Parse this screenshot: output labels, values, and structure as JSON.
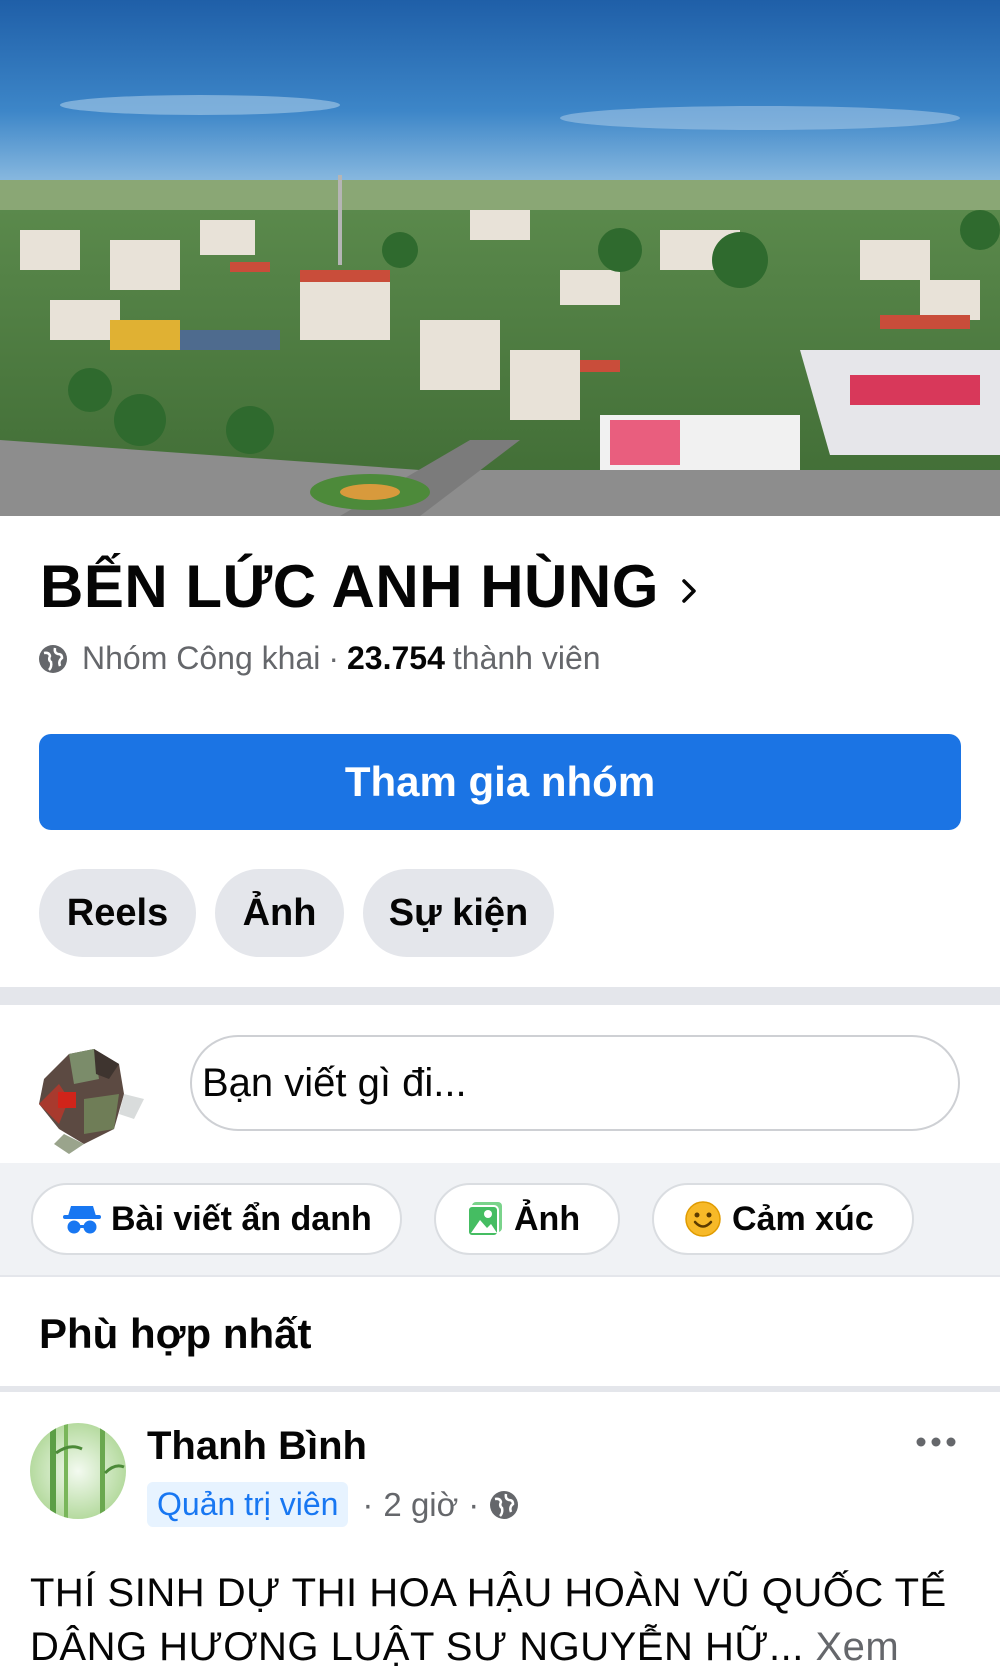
{
  "group": {
    "name": "BẾN LỨC ANH HÙNG",
    "privacy": "Nhóm Công khai",
    "separator": "·",
    "member_count": "23.754",
    "members_label": "thành viên",
    "join_label": "Tham gia nhóm"
  },
  "tabs": [
    {
      "label": "Reels"
    },
    {
      "label": "Ảnh"
    },
    {
      "label": "Sự kiện"
    }
  ],
  "composer": {
    "placeholder": "Bạn viết gì đi...",
    "actions": [
      {
        "label": "Bài viết ẩn danh",
        "icon": "anonymous-icon"
      },
      {
        "label": "Ảnh",
        "icon": "photo-icon"
      },
      {
        "label": "Cảm xúc",
        "icon": "smiley-icon"
      }
    ]
  },
  "feed": {
    "sort_label": "Phù hợp nhất"
  },
  "post": {
    "author": "Thanh Bình",
    "role_badge": "Quản trị viên",
    "time": "2 giờ",
    "dot": "·",
    "text": "THÍ SINH DỰ THI HOA HẬU HOÀN VŨ QUỐC TẾ DÂNG HƯƠNG LUẬT SƯ NGUYỄN HỮ...",
    "see_more": "Xem thêm"
  },
  "colors": {
    "primary": "#1b74e4",
    "chip_bg": "#e4e6eb",
    "secondary_text": "#65676b",
    "badge_bg": "#e7f3ff",
    "badge_text": "#1877f2"
  }
}
